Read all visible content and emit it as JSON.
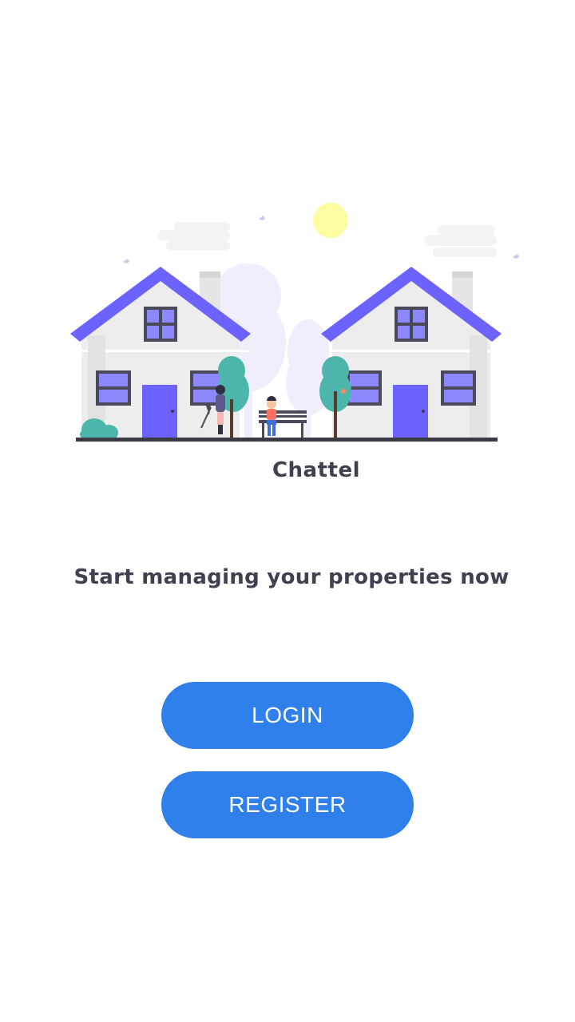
{
  "app": {
    "name": "Chattel",
    "tagline": "Start managing your properties now"
  },
  "actions": {
    "login_label": "LOGIN",
    "register_label": "REGISTER"
  },
  "colors": {
    "primary_button": "#2f80ea",
    "text": "#3d4150",
    "roof_and_door": "#6c63ff",
    "tree": "#4db6ac",
    "sun": "#fdfca0"
  },
  "illustration": {
    "icon": "neighborhood-houses-illustration"
  }
}
